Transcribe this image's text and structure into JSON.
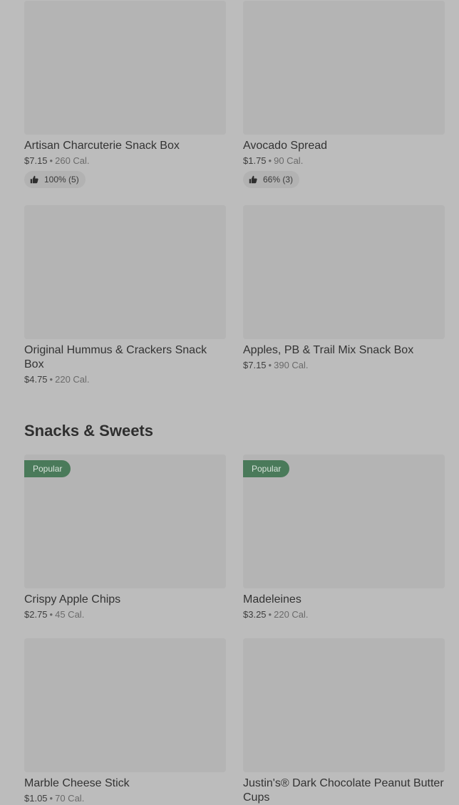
{
  "sections": {
    "snacks_title": "Snacks & Sweets"
  },
  "items": [
    {
      "name": "Artisan Charcuterie Snack Box",
      "price": "$7.15",
      "calories": "260 Cal.",
      "rating": "100% (5)"
    },
    {
      "name": "Avocado Spread",
      "price": "$1.75",
      "calories": "90 Cal.",
      "rating": "66% (3)"
    },
    {
      "name": "Original Hummus & Crackers Snack Box",
      "price": "$4.75",
      "calories": "220 Cal."
    },
    {
      "name": "Apples, PB & Trail Mix Snack Box",
      "price": "$7.15",
      "calories": "390 Cal."
    },
    {
      "name": "Crispy Apple Chips",
      "price": "$2.75",
      "calories": "45 Cal.",
      "badge": "Popular"
    },
    {
      "name": "Madeleines",
      "price": "$3.25",
      "calories": "220 Cal.",
      "badge": "Popular"
    },
    {
      "name": "Marble Cheese Stick",
      "price": "$1.05",
      "calories": "70 Cal."
    },
    {
      "name": "Justin's® Dark Chocolate Peanut Butter Cups",
      "price": "",
      "calories": ""
    }
  ],
  "meta_separator": "•",
  "icons": {
    "rating": "thumbs-up-icon"
  },
  "colors": {
    "background": "#bcbcbc",
    "thumbnail": "#b4b4b4",
    "badge": "#4a7a5a"
  }
}
